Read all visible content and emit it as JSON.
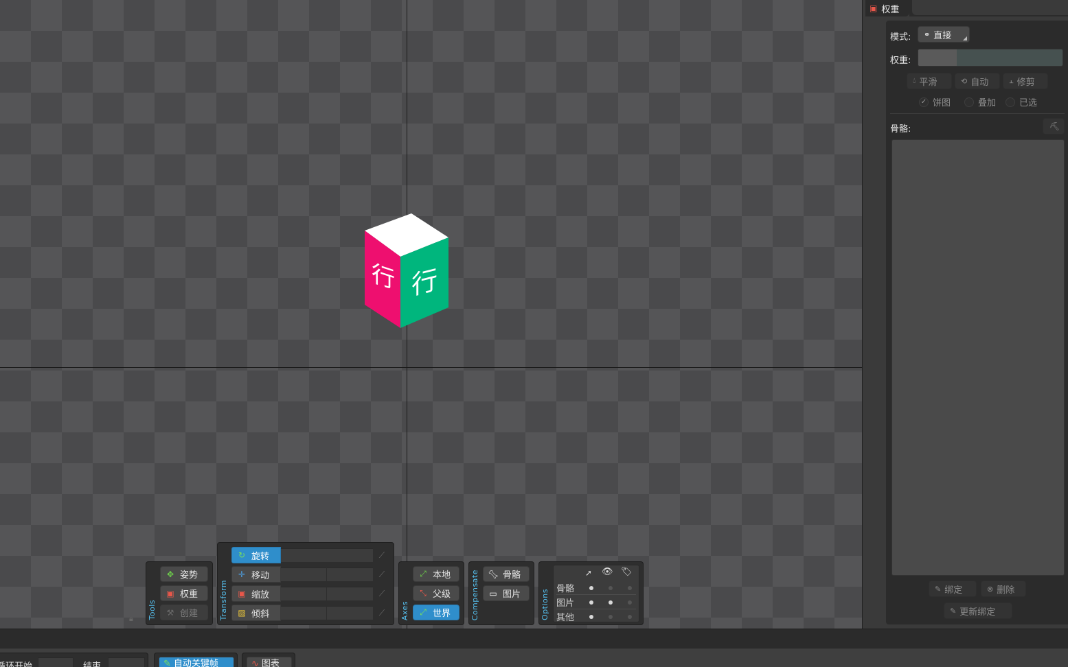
{
  "viewport": {
    "cube_text_left": "行",
    "cube_text_right": "行",
    "colors": {
      "cube_left": "#ee0f6f",
      "cube_right": "#00b67d",
      "cube_top": "#ffffff"
    }
  },
  "tools": {
    "label": "Tools",
    "pose": "姿势",
    "weights": "权重",
    "create": "创建"
  },
  "transform": {
    "label": "Transform",
    "rotate": "旋转",
    "translate": "移动",
    "scale": "缩放",
    "shear": "倾斜"
  },
  "axes": {
    "label": "Axes",
    "local": "本地",
    "parent": "父级",
    "world": "世界"
  },
  "compensate": {
    "label": "Compensate",
    "bones": "骨骼",
    "images": "图片"
  },
  "options": {
    "label": "Options",
    "rows": [
      "骨骼",
      "图片",
      "其他"
    ]
  },
  "bottom": {
    "loop_start": "循环开始",
    "end": "结束",
    "auto_key": "自动关键帧",
    "graph": "图表"
  },
  "panel": {
    "tab_title": "权重",
    "mode_label": "模式:",
    "mode_value": "直接",
    "weight_label": "权重:",
    "smooth": "平滑",
    "auto": "自动",
    "prune": "修剪",
    "pie": "饼图",
    "overlay": "叠加",
    "selected": "已选",
    "bones_label": "骨骼:",
    "bind": "绑定",
    "remove": "删除",
    "update_binding": "更新绑定"
  }
}
